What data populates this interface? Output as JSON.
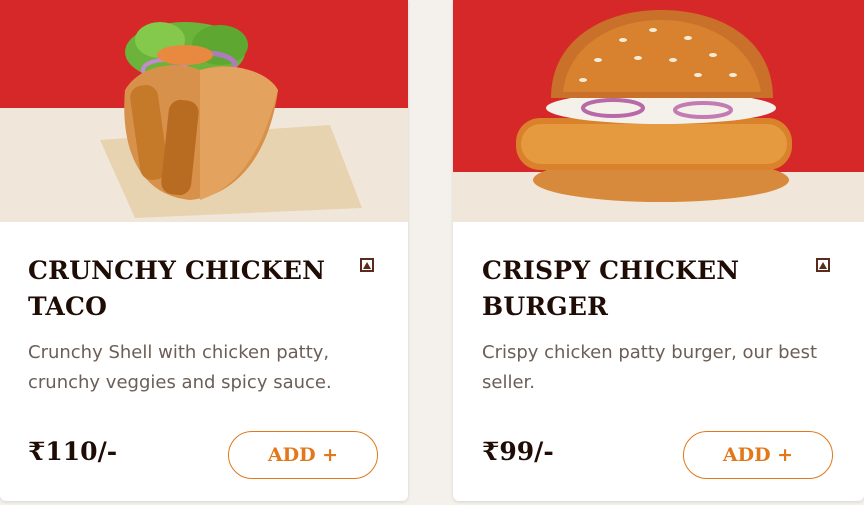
{
  "colors": {
    "brand_red": "#d62828",
    "cream": "#f0e6da",
    "accent_orange": "#e2781a",
    "title_brown": "#1e0c05"
  },
  "products": [
    {
      "name": "CRUNCHY CHICKEN TACO",
      "description": "Crunchy Shell with chicken patty, crunchy veggies and spicy sauce.",
      "price": "₹110/-",
      "add_label": "ADD +",
      "image_icon": "chicken-taco-image",
      "diet_icon": "non-veg-icon"
    },
    {
      "name": "CRISPY CHICKEN BURGER",
      "description": "Crispy chicken patty burger, our best seller.",
      "price": "₹99/-",
      "add_label": "ADD +",
      "image_icon": "chicken-burger-image",
      "diet_icon": "non-veg-icon"
    }
  ]
}
